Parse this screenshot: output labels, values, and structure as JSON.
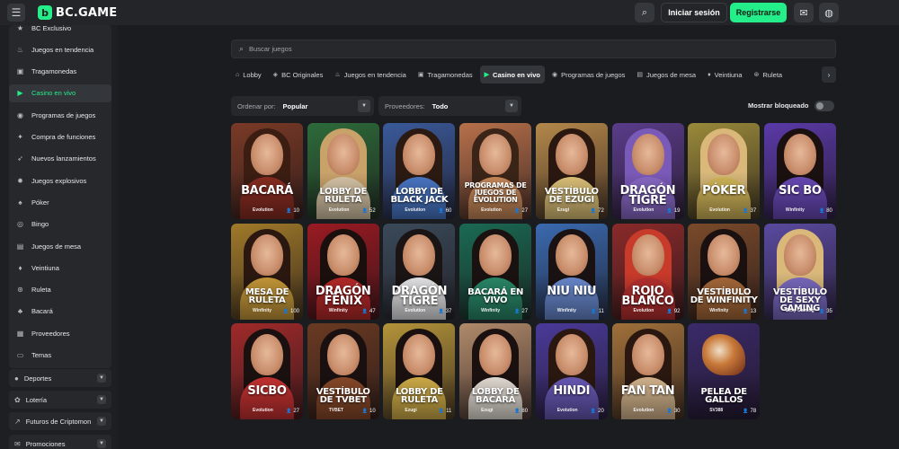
{
  "topbar": {
    "brand": "BC.GAME",
    "logo_mark": "b",
    "menu_icon": "menu-icon",
    "search_icon": "search-user-icon",
    "login_label": "Iniciar sesión",
    "register_label": "Registrarse",
    "chat_icon": "chat-icon",
    "language_icon": "globe-icon"
  },
  "sidebar": {
    "items": [
      {
        "label": "BC Exclusivo",
        "icon": "star-icon"
      },
      {
        "label": "Juegos en tendencia",
        "icon": "flame-icon"
      },
      {
        "label": "Tragamonedas",
        "icon": "slot-icon"
      },
      {
        "label": "Casino en vivo",
        "icon": "live-icon",
        "active": true
      },
      {
        "label": "Programas de juegos",
        "icon": "show-icon"
      },
      {
        "label": "Compra de funciones",
        "icon": "feature-icon"
      },
      {
        "label": "Nuevos lanzamientos",
        "icon": "rocket-icon"
      },
      {
        "label": "Juegos explosivos",
        "icon": "bomb-icon"
      },
      {
        "label": "Póker",
        "icon": "spade-icon"
      },
      {
        "label": "Bingo",
        "icon": "bingo-icon"
      },
      {
        "label": "Juegos de mesa",
        "icon": "table-icon"
      },
      {
        "label": "Veintiuna",
        "icon": "cards-icon"
      },
      {
        "label": "Ruleta",
        "icon": "roulette-icon"
      },
      {
        "label": "Bacará",
        "icon": "baccarat-icon"
      },
      {
        "label": "Proveedores",
        "icon": "provider-icon"
      },
      {
        "label": "Temas",
        "icon": "theme-icon"
      }
    ],
    "groups": [
      {
        "label": "Deportes",
        "icon": "ball-icon"
      },
      {
        "label": "Lotería",
        "icon": "lottery-icon"
      },
      {
        "label": "Futuros de Criptomon",
        "icon": "chart-icon"
      },
      {
        "label": "Promociones",
        "icon": "gift-icon"
      }
    ],
    "accent": "#24ee89"
  },
  "search": {
    "placeholder": "Buscar juegos"
  },
  "tabs": [
    {
      "label": "Lobby",
      "icon": "home-icon"
    },
    {
      "label": "BC Originales",
      "icon": "bc-icon"
    },
    {
      "label": "Juegos en tendencia",
      "icon": "flame-icon"
    },
    {
      "label": "Tragamonedas",
      "icon": "slot-icon"
    },
    {
      "label": "Casino en vivo",
      "icon": "live-icon",
      "active": true
    },
    {
      "label": "Programas de juegos",
      "icon": "show-icon"
    },
    {
      "label": "Juegos de mesa",
      "icon": "table-icon"
    },
    {
      "label": "Veintiuna",
      "icon": "cards-icon"
    },
    {
      "label": "Ruleta",
      "icon": "roulette-icon"
    }
  ],
  "filters": {
    "sort_label": "Ordenar por:",
    "sort_value": "Popular",
    "provider_label": "Proveedores:",
    "provider_value": "Todo",
    "show_blocked_label": "Mostrar bloqueado",
    "show_blocked_on": false
  },
  "games": [
    {
      "title": "BACARÁ",
      "provider": "Evolution",
      "players": "10",
      "bg": "#7a3a26",
      "hair": "#3b1d12",
      "dress": "#8a2d22"
    },
    {
      "title": "LOBBY DE RULETA",
      "provider": "Evolution",
      "players": "52",
      "bg": "#2d6b3a",
      "hair": "#c9a26a",
      "dress": "#d9c7a8"
    },
    {
      "title": "LOBBY DE BLACK JACK",
      "provider": "Evolution",
      "players": "60",
      "bg": "#3a5a9a",
      "hair": "#2a1a12",
      "dress": "#4a78c8"
    },
    {
      "title": "PROGRAMAS DE JUEGOS DE EVOLUTION",
      "provider": "Evolution",
      "players": "27",
      "bg": "#b7704a",
      "hair": "#3a2418",
      "dress": "#c98a5a"
    },
    {
      "title": "VESTÍBULO DE EZUGI",
      "provider": "Ezugi",
      "players": "72",
      "bg": "#b4884a",
      "hair": "#2a1810",
      "dress": "#e0c47a"
    },
    {
      "title": "DRAGÓN TIGRE",
      "provider": "Evolution",
      "players": "19",
      "bg": "#5a3c8a",
      "hair": "#7a5ab8",
      "dress": "#8a6ac8"
    },
    {
      "title": "PÓKER",
      "provider": "Evolution",
      "players": "37",
      "bg": "#9a8a3a",
      "hair": "#d9b87a",
      "dress": "#d4b85a"
    },
    {
      "title": "SIC BO",
      "provider": "Winfinity",
      "players": "80",
      "bg": "#5a3aa8",
      "hair": "#1a1010",
      "dress": "#6a4ab8"
    },
    {
      "title": "MESA DE RULETA",
      "provider": "Winfinity",
      "players": "100",
      "bg": "#a07a2a",
      "hair": "#2a1810",
      "dress": "#c89a3a"
    },
    {
      "title": "DRAGÓN FÉNIX",
      "provider": "Winfinity",
      "players": "47",
      "bg": "#9a1a22",
      "hair": "#1a0f0c",
      "dress": "#b82a2a"
    },
    {
      "title": "DRAGÓN TIGRE",
      "provider": "Evolution",
      "players": "37",
      "bg": "#3a4a5a",
      "hair": "#1a1414",
      "dress": "#e8e8ea"
    },
    {
      "title": "BACARÁ EN VIVO",
      "provider": "Winfinity",
      "players": "27",
      "bg": "#1a6a52",
      "hair": "#1a1210",
      "dress": "#2a8a6a"
    },
    {
      "title": "NIU NIU",
      "provider": "Winfinity",
      "players": "11",
      "bg": "#3a6ab0",
      "hair": "#1a1212",
      "dress": "#6a8ad0"
    },
    {
      "title": "ROJO BLANCO",
      "provider": "Evolution",
      "players": "92",
      "bg": "#8a2a2a",
      "hair": "#c83a2a",
      "dress": "#b83030"
    },
    {
      "title": "VESTÍBULO DE WINFINITY",
      "provider": "Winfinity",
      "players": "13",
      "bg": "#7a4a2a",
      "hair": "#1a1010",
      "dress": "#a86a3a"
    },
    {
      "title": "VESTÍBULO DE SEXY GAMING",
      "provider": "Sexy Gaming",
      "players": "35",
      "bg": "#5a4aa0",
      "hair": "#d9b87a",
      "dress": "#7a6ac0"
    },
    {
      "title": "SICBO",
      "provider": "Evolution",
      "players": "27",
      "bg": "#a02a2a",
      "hair": "#1a1010",
      "dress": "#c83232"
    },
    {
      "title": "VESTÍBULO DE TVBET",
      "provider": "TVBET",
      "players": "10",
      "bg": "#6a3a22",
      "hair": "#1a1010",
      "dress": "#8a4a2a"
    },
    {
      "title": "LOBBY DE RULETA",
      "provider": "Ezugi",
      "players": "11",
      "bg": "#b4943a",
      "hair": "#1a1010",
      "dress": "#d4b04a"
    },
    {
      "title": "LOBBY DE BACARÁ",
      "provider": "Ezugi",
      "players": "80",
      "bg": "#b08a6a",
      "hair": "#1a1010",
      "dress": "#e8e0d8"
    },
    {
      "title": "HINDI",
      "provider": "Evolution",
      "players": "20",
      "bg": "#4a3a9a",
      "hair": "#2a1810",
      "dress": "#6a5ab8"
    },
    {
      "title": "FAN TAN",
      "provider": "Evolution",
      "players": "30",
      "bg": "#a0703a",
      "hair": "#2a1810",
      "dress": "#d8b890"
    },
    {
      "title": "PELEA DE GALLOS",
      "provider": "SV388",
      "players": "78",
      "bg": "#3a2a6a",
      "hair": "#6a2a16",
      "dress": "#4a3a8a",
      "rooster": true
    }
  ]
}
